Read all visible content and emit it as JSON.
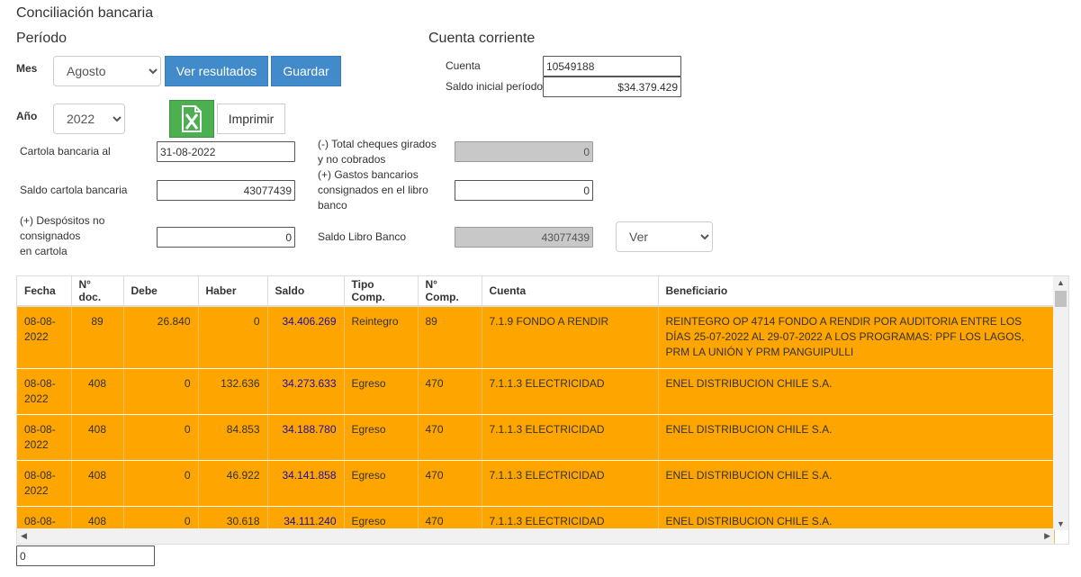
{
  "title": "Conciliación bancaria",
  "periodo": {
    "heading": "Período",
    "mes_label": "Mes",
    "mes_value": "Agosto",
    "anio_label": "Año",
    "anio_value": "2022",
    "ver_resultados": "Ver resultados",
    "guardar": "Guardar",
    "imprimir": "Imprimir"
  },
  "cuenta_corriente": {
    "heading": "Cuenta corriente",
    "cuenta_label": "Cuenta",
    "cuenta_value": "10549188",
    "saldo_inicial_label": "Saldo inicial período",
    "saldo_inicial_value": "$34.379.429"
  },
  "form": {
    "cartola_label": "Cartola bancaria al",
    "cartola_value": "31-08-2022",
    "saldo_cartola_label": "Saldo cartola bancaria",
    "saldo_cartola_value": "43077439",
    "depositos_label_1": "(+) Despósitos no",
    "depositos_label_2": "consignados",
    "depositos_label_3": "en cartola",
    "depositos_value": "0",
    "cheques_label_1": "(-) Total cheques girados",
    "cheques_label_2": "y no cobrados",
    "cheques_value": "0",
    "gastos_label_1": "(+) Gastos bancarios",
    "gastos_label_2": "consignados en el libro",
    "gastos_label_3": "banco",
    "gastos_value": "0",
    "saldo_libro_label": "Saldo Libro Banco",
    "saldo_libro_value": "43077439",
    "ver_select": "Ver"
  },
  "table": {
    "headers": [
      "Fecha",
      "N° doc.",
      "Debe",
      "Haber",
      "Saldo",
      "Tipo Comp.",
      "N° Comp.",
      "Cuenta",
      "Beneficiario"
    ],
    "rows": [
      {
        "fecha_1": "08-08-",
        "fecha_2": "2022",
        "doc": "89",
        "debe": "26.840",
        "haber": "0",
        "saldo": "34.406.269",
        "tipo": "Reintegro",
        "ncomp": "89",
        "cuenta": "7.1.9 FONDO A RENDIR",
        "benef": "REINTEGRO OP 4714 FONDO A RENDIR POR AUDITORIA ENTRE LOS DÍAS 25-07-2022 AL 29-07-2022 A LOS PROGRAMAS: PPF LOS LAGOS, PRM LA UNIÓN Y PRM PANGUIPULLI"
      },
      {
        "fecha_1": "08-08-",
        "fecha_2": "2022",
        "doc": "408",
        "debe": "0",
        "haber": "132.636",
        "saldo": "34.273.633",
        "tipo": "Egreso",
        "ncomp": "470",
        "cuenta": "7.1.1.3 ELECTRICIDAD",
        "benef": "ENEL DISTRIBUCION CHILE S.A."
      },
      {
        "fecha_1": "08-08-",
        "fecha_2": "2022",
        "doc": "408",
        "debe": "0",
        "haber": "84.853",
        "saldo": "34.188.780",
        "tipo": "Egreso",
        "ncomp": "470",
        "cuenta": "7.1.1.3 ELECTRICIDAD",
        "benef": "ENEL DISTRIBUCION CHILE S.A."
      },
      {
        "fecha_1": "08-08-",
        "fecha_2": "2022",
        "doc": "408",
        "debe": "0",
        "haber": "46.922",
        "saldo": "34.141.858",
        "tipo": "Egreso",
        "ncomp": "470",
        "cuenta": "7.1.1.3 ELECTRICIDAD",
        "benef": "ENEL DISTRIBUCION CHILE S.A."
      },
      {
        "fecha_1": "08-08-",
        "fecha_2": "",
        "doc": "408",
        "debe": "0",
        "haber": "30.618",
        "saldo": "34.111.240",
        "tipo": "Egreso",
        "ncomp": "470",
        "cuenta": "7.1.1.3 ELECTRICIDAD",
        "benef": "ENEL DISTRIBUCION CHILE S.A."
      }
    ]
  },
  "footer_input_value": "0",
  "icons": {
    "excel": "excel-export-icon",
    "dropdown": "chevron-down-icon"
  },
  "colors": {
    "row_bg": "#ffa500",
    "button_blue": "#428bca",
    "excel_green": "#4caf50",
    "saldo_link": "#1a0dab"
  }
}
